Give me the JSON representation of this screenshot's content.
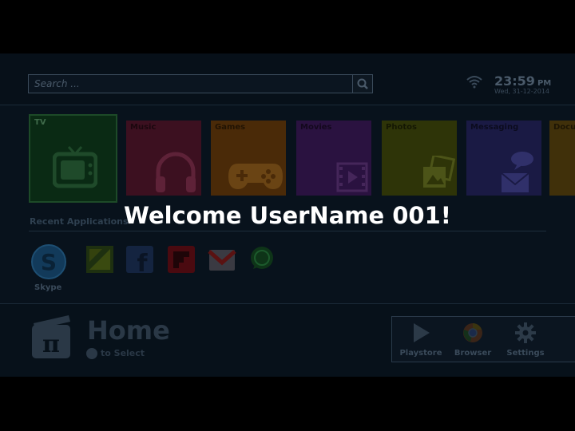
{
  "search": {
    "placeholder": "Search ..."
  },
  "status": {
    "time": "23:59",
    "ampm": "PM",
    "date": "Wed, 31-12-2014"
  },
  "tiles": [
    {
      "label": "TV",
      "icon": "tv-icon",
      "color": "#0a2a14"
    },
    {
      "label": "Music",
      "icon": "headphones-icon",
      "color": "#3c1020"
    },
    {
      "label": "Games",
      "icon": "gamepad-icon",
      "color": "#4a2a08"
    },
    {
      "label": "Movies",
      "icon": "film-icon",
      "color": "#2a1240"
    },
    {
      "label": "Photos",
      "icon": "photos-icon",
      "color": "#2e3408"
    },
    {
      "label": "Messaging",
      "icon": "message-icon",
      "color": "#1a1a44"
    },
    {
      "label": "Docu",
      "icon": "documents-icon",
      "color": "#40300a"
    }
  ],
  "recent": {
    "title": "Recent Applications",
    "apps": [
      {
        "name": "Skype",
        "icon": "skype-icon"
      },
      {
        "name": "",
        "icon": "saavn-icon"
      },
      {
        "name": "",
        "icon": "facebook-icon"
      },
      {
        "name": "",
        "icon": "flipboard-icon"
      },
      {
        "name": "",
        "icon": "gmail-icon"
      },
      {
        "name": "",
        "icon": "whatsapp-icon"
      }
    ]
  },
  "welcome": "Welcome UserName 001!",
  "footer": {
    "title": "Home",
    "hint": "to Select",
    "quick": [
      {
        "label": "Playstore",
        "icon": "play-store-icon"
      },
      {
        "label": "Browser",
        "icon": "chrome-icon"
      },
      {
        "label": "Settings",
        "icon": "gear-icon"
      }
    ]
  }
}
